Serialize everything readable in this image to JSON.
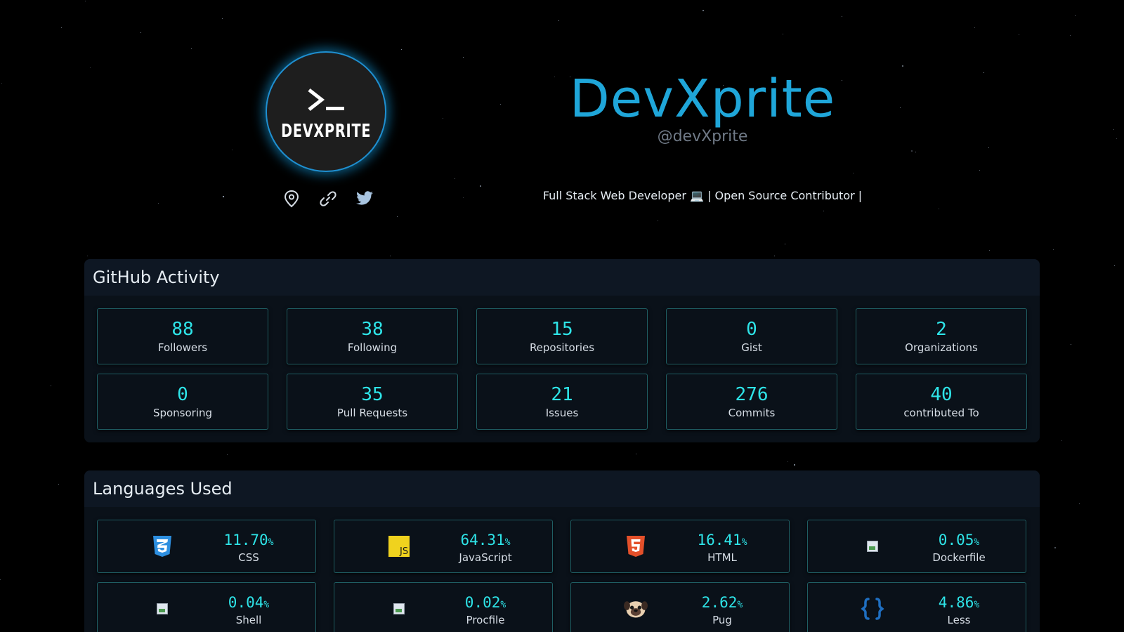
{
  "profile": {
    "avatar_text": "DEVXPRITE",
    "name": "DevXprite",
    "handle": "@devXprite",
    "bio": "Full Stack Web Developer 💻 | Open Source Contributor |"
  },
  "social": {
    "icons": [
      "location-icon",
      "link-icon",
      "twitter-icon"
    ]
  },
  "activity": {
    "title": "GitHub Activity",
    "stats": [
      {
        "value": "88",
        "label": "Followers"
      },
      {
        "value": "38",
        "label": "Following"
      },
      {
        "value": "15",
        "label": "Repositories"
      },
      {
        "value": "0",
        "label": "Gist"
      },
      {
        "value": "2",
        "label": "Organizations"
      },
      {
        "value": "0",
        "label": "Sponsoring"
      },
      {
        "value": "35",
        "label": "Pull Requests"
      },
      {
        "value": "21",
        "label": "Issues"
      },
      {
        "value": "276",
        "label": "Commits"
      },
      {
        "value": "40",
        "label": "contributed To"
      }
    ]
  },
  "languages": {
    "title": "Languages Used",
    "items": [
      {
        "percent": "11.70",
        "unit": "%",
        "name": "CSS",
        "icon": "css3-icon"
      },
      {
        "percent": "64.31",
        "unit": "%",
        "name": "JavaScript",
        "icon": "javascript-icon"
      },
      {
        "percent": "16.41",
        "unit": "%",
        "name": "HTML",
        "icon": "html5-icon"
      },
      {
        "percent": "0.05",
        "unit": "%",
        "name": "Dockerfile",
        "icon": "broken-image-icon"
      },
      {
        "percent": "0.04",
        "unit": "%",
        "name": "Shell",
        "icon": "broken-image-icon"
      },
      {
        "percent": "0.02",
        "unit": "%",
        "name": "Procfile",
        "icon": "broken-image-icon"
      },
      {
        "percent": "2.62",
        "unit": "%",
        "name": "Pug",
        "icon": "pug-icon"
      },
      {
        "percent": "4.86",
        "unit": "%",
        "name": "Less",
        "icon": "less-icon"
      }
    ]
  },
  "colors": {
    "accent": "#2ee4e8",
    "name": "#1fa6d9",
    "background": "#000000",
    "panel": "#0a1119",
    "card_border": "#1f5e63"
  }
}
